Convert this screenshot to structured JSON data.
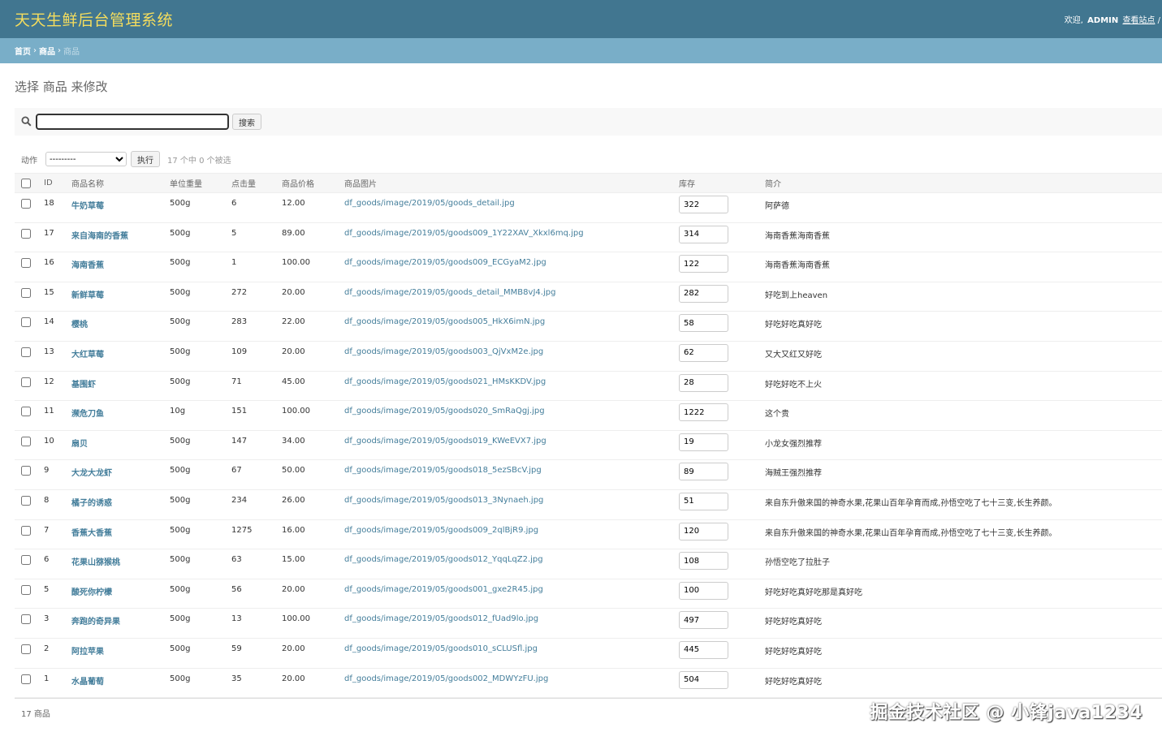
{
  "header": {
    "site_name": "天天生鲜后台管理系统",
    "welcome": "欢迎,",
    "user": "ADMIN",
    "view_site": "查看站点",
    "sep": "/"
  },
  "breadcrumbs": {
    "home": "首页",
    "app": "商品",
    "current": "商品"
  },
  "page_title": "选择 商品 来修改",
  "search": {
    "value": "",
    "button": "搜索"
  },
  "actions": {
    "label": "动作",
    "selected": "---------",
    "run": "执行",
    "counter": "17 个中 0 个被选"
  },
  "columns": [
    "ID",
    "商品名称",
    "单位重量",
    "点击量",
    "商品价格",
    "商品图片",
    "库存",
    "简介"
  ],
  "rows": [
    {
      "id": "18",
      "name": "牛奶草莓",
      "unit": "500g",
      "clicks": "6",
      "price": "12.00",
      "image": "df_goods/image/2019/05/goods_detail.jpg",
      "stock": "322",
      "desc": "阿萨德"
    },
    {
      "id": "17",
      "name": "来自海南的香蕉",
      "unit": "500g",
      "clicks": "5",
      "price": "89.00",
      "image": "df_goods/image/2019/05/goods009_1Y22XAV_Xkxl6mq.jpg",
      "stock": "314",
      "desc": "海南香蕉海南香蕉"
    },
    {
      "id": "16",
      "name": "海南香蕉",
      "unit": "500g",
      "clicks": "1",
      "price": "100.00",
      "image": "df_goods/image/2019/05/goods009_ECGyaM2.jpg",
      "stock": "122",
      "desc": "海南香蕉海南香蕉"
    },
    {
      "id": "15",
      "name": "新鲜草莓",
      "unit": "500g",
      "clicks": "272",
      "price": "20.00",
      "image": "df_goods/image/2019/05/goods_detail_MMB8vJ4.jpg",
      "stock": "282",
      "desc": "好吃到上heaven"
    },
    {
      "id": "14",
      "name": "樱桃",
      "unit": "500g",
      "clicks": "283",
      "price": "22.00",
      "image": "df_goods/image/2019/05/goods005_HkX6imN.jpg",
      "stock": "58",
      "desc": "好吃好吃真好吃"
    },
    {
      "id": "13",
      "name": "大红草莓",
      "unit": "500g",
      "clicks": "109",
      "price": "20.00",
      "image": "df_goods/image/2019/05/goods003_QjVxM2e.jpg",
      "stock": "62",
      "desc": "又大又红又好吃"
    },
    {
      "id": "12",
      "name": "基围虾",
      "unit": "500g",
      "clicks": "71",
      "price": "45.00",
      "image": "df_goods/image/2019/05/goods021_HMsKKDV.jpg",
      "stock": "28",
      "desc": "好吃好吃不上火"
    },
    {
      "id": "11",
      "name": "濒危刀鱼",
      "unit": "10g",
      "clicks": "151",
      "price": "100.00",
      "image": "df_goods/image/2019/05/goods020_SmRaQgj.jpg",
      "stock": "1222",
      "desc": "这个贵"
    },
    {
      "id": "10",
      "name": "扇贝",
      "unit": "500g",
      "clicks": "147",
      "price": "34.00",
      "image": "df_goods/image/2019/05/goods019_KWeEVX7.jpg",
      "stock": "19",
      "desc": "小龙女强烈推荐"
    },
    {
      "id": "9",
      "name": "大龙大龙虾",
      "unit": "500g",
      "clicks": "67",
      "price": "50.00",
      "image": "df_goods/image/2019/05/goods018_5ezSBcV.jpg",
      "stock": "89",
      "desc": "海贼王强烈推荐"
    },
    {
      "id": "8",
      "name": "橘子的诱惑",
      "unit": "500g",
      "clicks": "234",
      "price": "26.00",
      "image": "df_goods/image/2019/05/goods013_3Nynaeh.jpg",
      "stock": "51",
      "desc": "来自东升傲来国的神奇水果,花果山百年孕育而成,孙悟空吃了七十三变,长生养颜。"
    },
    {
      "id": "7",
      "name": "香蕉大香蕉",
      "unit": "500g",
      "clicks": "1275",
      "price": "16.00",
      "image": "df_goods/image/2019/05/goods009_2qlBjR9.jpg",
      "stock": "120",
      "desc": "来自东升傲来国的神奇水果,花果山百年孕育而成,孙悟空吃了七十三变,长生养颜。"
    },
    {
      "id": "6",
      "name": "花果山猕猴桃",
      "unit": "500g",
      "clicks": "63",
      "price": "15.00",
      "image": "df_goods/image/2019/05/goods012_YqqLqZ2.jpg",
      "stock": "108",
      "desc": "孙悟空吃了拉肚子"
    },
    {
      "id": "5",
      "name": "酸死你柠檬",
      "unit": "500g",
      "clicks": "56",
      "price": "20.00",
      "image": "df_goods/image/2019/05/goods001_gxe2R45.jpg",
      "stock": "100",
      "desc": "好吃好吃真好吃那是真好吃"
    },
    {
      "id": "3",
      "name": "奔跑的奇异果",
      "unit": "500g",
      "clicks": "13",
      "price": "100.00",
      "image": "df_goods/image/2019/05/goods012_fUad9lo.jpg",
      "stock": "497",
      "desc": "好吃好吃真好吃"
    },
    {
      "id": "2",
      "name": "阿拉苹果",
      "unit": "500g",
      "clicks": "59",
      "price": "20.00",
      "image": "df_goods/image/2019/05/goods010_sCLUSfl.jpg",
      "stock": "445",
      "desc": "好吃好吃真好吃"
    },
    {
      "id": "1",
      "name": "水晶葡萄",
      "unit": "500g",
      "clicks": "35",
      "price": "20.00",
      "image": "df_goods/image/2019/05/goods002_MDWYzFU.jpg",
      "stock": "504",
      "desc": "好吃好吃真好吃"
    }
  ],
  "paginator": "17 商品",
  "watermark": "掘金技术社区 @ 小锋java1234",
  "colors": {
    "header": "#417690",
    "breadcrumbs": "#79aec8",
    "link": "#447e9b",
    "site_name": "#f5dd5d"
  }
}
